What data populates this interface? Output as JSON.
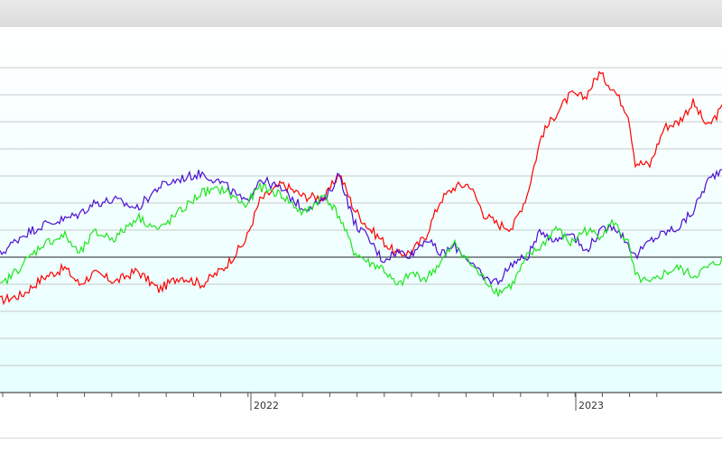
{
  "colors": {
    "background_gradient_top": "#ffffff",
    "background_gradient_bottom": "#e6ffff",
    "grid": "#c8c8c8",
    "baseline": "#222222"
  },
  "chart_data": {
    "type": "line",
    "title": "",
    "xlabel": "",
    "ylabel": "",
    "x_tick_labels": [
      "2022",
      "2023"
    ],
    "x_range": [
      "2021-01",
      "2023-12"
    ],
    "y_range": [
      -100,
      160
    ],
    "grid": true,
    "baseline_value": 0,
    "series": [
      {
        "color": "#ff0000",
        "values": [
          [
            0,
            -32
          ],
          [
            0.03,
            -28
          ],
          [
            0.06,
            -15
          ],
          [
            0.09,
            -8
          ],
          [
            0.11,
            -20
          ],
          [
            0.13,
            -12
          ],
          [
            0.16,
            -18
          ],
          [
            0.19,
            -10
          ],
          [
            0.22,
            -24
          ],
          [
            0.25,
            -14
          ],
          [
            0.28,
            -20
          ],
          [
            0.31,
            -8
          ],
          [
            0.34,
            12
          ],
          [
            0.36,
            42
          ],
          [
            0.39,
            54
          ],
          [
            0.42,
            45
          ],
          [
            0.45,
            44
          ],
          [
            0.47,
            62
          ],
          [
            0.49,
            36
          ],
          [
            0.51,
            22
          ],
          [
            0.53,
            12
          ],
          [
            0.55,
            2
          ],
          [
            0.57,
            4
          ],
          [
            0.59,
            16
          ],
          [
            0.61,
            42
          ],
          [
            0.63,
            52
          ],
          [
            0.65,
            54
          ],
          [
            0.67,
            32
          ],
          [
            0.69,
            24
          ],
          [
            0.71,
            22
          ],
          [
            0.73,
            46
          ],
          [
            0.75,
            90
          ],
          [
            0.77,
            106
          ],
          [
            0.79,
            120
          ],
          [
            0.81,
            118
          ],
          [
            0.83,
            136
          ],
          [
            0.85,
            124
          ],
          [
            0.87,
            106
          ],
          [
            0.88,
            70
          ],
          [
            0.9,
            68
          ],
          [
            0.92,
            96
          ],
          [
            0.94,
            100
          ],
          [
            0.96,
            114
          ],
          [
            0.98,
            96
          ],
          [
            1.0,
            110
          ]
        ]
      },
      {
        "color": "#4b0fd2",
        "values": [
          [
            0,
            2
          ],
          [
            0.03,
            16
          ],
          [
            0.06,
            24
          ],
          [
            0.09,
            28
          ],
          [
            0.11,
            32
          ],
          [
            0.13,
            40
          ],
          [
            0.16,
            42
          ],
          [
            0.19,
            36
          ],
          [
            0.22,
            52
          ],
          [
            0.25,
            58
          ],
          [
            0.28,
            62
          ],
          [
            0.31,
            54
          ],
          [
            0.34,
            40
          ],
          [
            0.36,
            58
          ],
          [
            0.39,
            50
          ],
          [
            0.42,
            36
          ],
          [
            0.45,
            42
          ],
          [
            0.47,
            62
          ],
          [
            0.49,
            26
          ],
          [
            0.51,
            14
          ],
          [
            0.53,
            -2
          ],
          [
            0.55,
            4
          ],
          [
            0.57,
            2
          ],
          [
            0.59,
            14
          ],
          [
            0.61,
            2
          ],
          [
            0.63,
            8
          ],
          [
            0.65,
            -2
          ],
          [
            0.67,
            -16
          ],
          [
            0.69,
            -18
          ],
          [
            0.71,
            -4
          ],
          [
            0.73,
            0
          ],
          [
            0.75,
            20
          ],
          [
            0.77,
            12
          ],
          [
            0.79,
            20
          ],
          [
            0.81,
            4
          ],
          [
            0.83,
            18
          ],
          [
            0.85,
            24
          ],
          [
            0.87,
            10
          ],
          [
            0.88,
            0
          ],
          [
            0.9,
            12
          ],
          [
            0.92,
            18
          ],
          [
            0.94,
            22
          ],
          [
            0.96,
            34
          ],
          [
            0.98,
            56
          ],
          [
            1.0,
            66
          ]
        ]
      },
      {
        "color": "#1ee61e",
        "values": [
          [
            0,
            -22
          ],
          [
            0.03,
            -6
          ],
          [
            0.06,
            10
          ],
          [
            0.09,
            16
          ],
          [
            0.11,
            2
          ],
          [
            0.13,
            18
          ],
          [
            0.16,
            14
          ],
          [
            0.19,
            30
          ],
          [
            0.22,
            20
          ],
          [
            0.25,
            34
          ],
          [
            0.28,
            48
          ],
          [
            0.31,
            50
          ],
          [
            0.34,
            38
          ],
          [
            0.36,
            52
          ],
          [
            0.39,
            46
          ],
          [
            0.42,
            32
          ],
          [
            0.45,
            46
          ],
          [
            0.47,
            30
          ],
          [
            0.49,
            4
          ],
          [
            0.51,
            -4
          ],
          [
            0.53,
            -8
          ],
          [
            0.55,
            -22
          ],
          [
            0.57,
            -12
          ],
          [
            0.59,
            -16
          ],
          [
            0.61,
            -4
          ],
          [
            0.63,
            10
          ],
          [
            0.65,
            -4
          ],
          [
            0.67,
            -16
          ],
          [
            0.69,
            -26
          ],
          [
            0.71,
            -20
          ],
          [
            0.73,
            0
          ],
          [
            0.75,
            8
          ],
          [
            0.77,
            22
          ],
          [
            0.79,
            10
          ],
          [
            0.81,
            20
          ],
          [
            0.83,
            16
          ],
          [
            0.85,
            26
          ],
          [
            0.87,
            10
          ],
          [
            0.88,
            -14
          ],
          [
            0.9,
            -20
          ],
          [
            0.92,
            -12
          ],
          [
            0.94,
            -8
          ],
          [
            0.96,
            -14
          ],
          [
            0.98,
            -8
          ],
          [
            1.0,
            -2
          ]
        ]
      }
    ]
  }
}
